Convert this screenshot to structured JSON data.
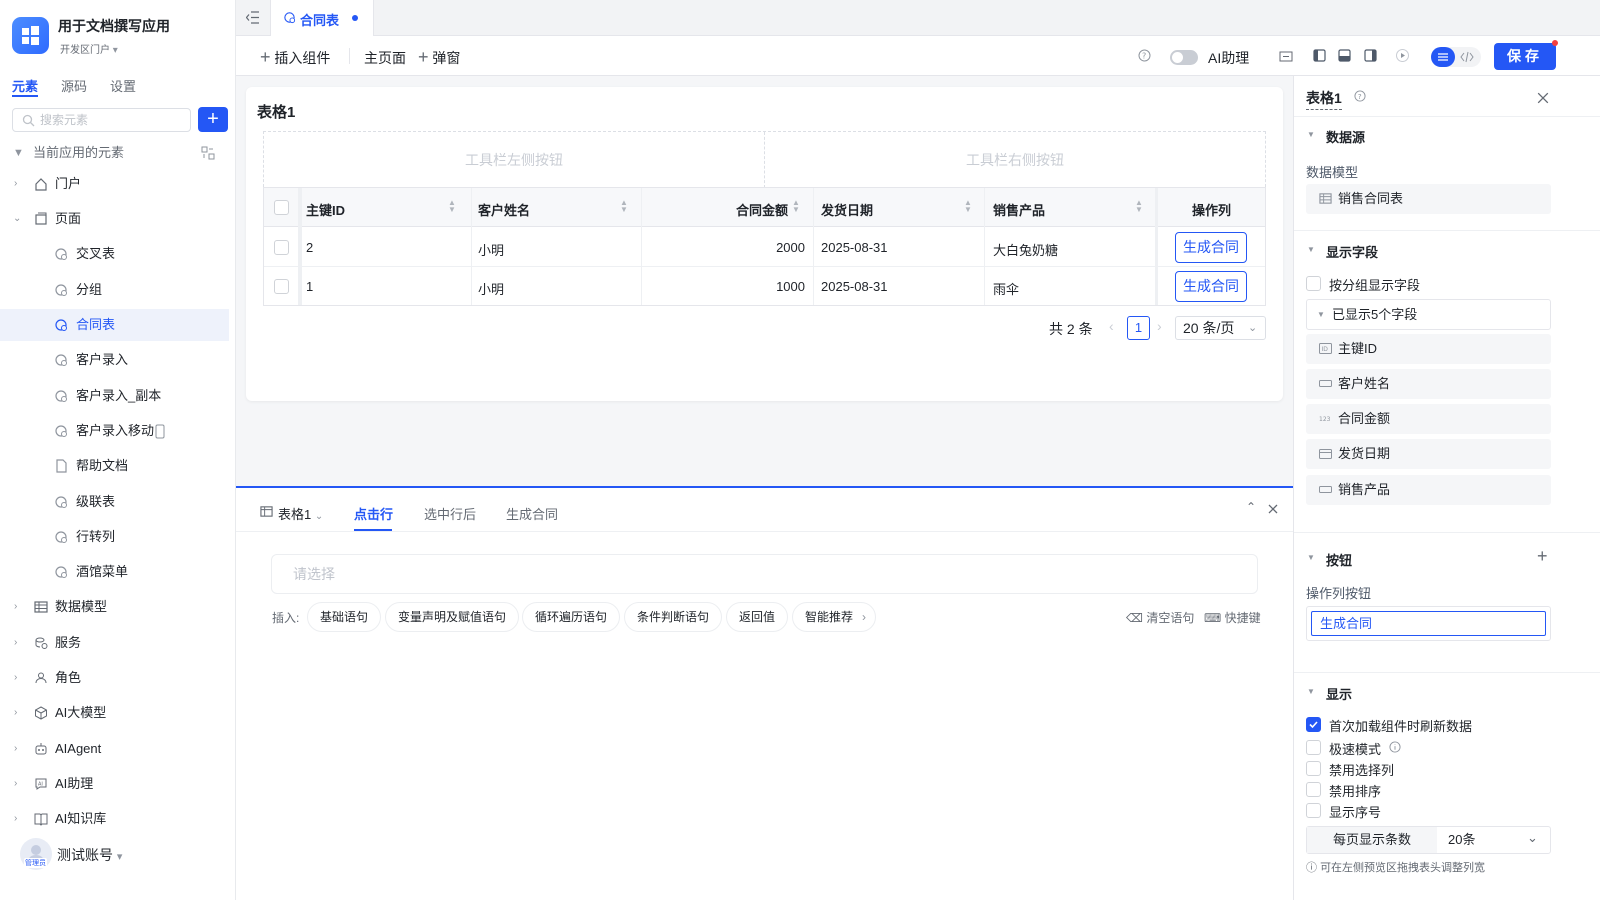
{
  "app": {
    "title": "用于文档撰写应用",
    "subtitle": "开发区门户"
  },
  "left_tabs": [
    "元素",
    "源码",
    "设置"
  ],
  "search": {
    "placeholder": "搜索元素"
  },
  "tree": {
    "root_label": "当前应用的元素",
    "items": [
      {
        "label": "门户"
      },
      {
        "label": "页面"
      },
      {
        "label": "交叉表"
      },
      {
        "label": "分组"
      },
      {
        "label": "合同表"
      },
      {
        "label": "客户录入"
      },
      {
        "label": "客户录入_副本"
      },
      {
        "label": "客户录入移动"
      },
      {
        "label": "帮助文档"
      },
      {
        "label": "级联表"
      },
      {
        "label": "行转列"
      },
      {
        "label": "酒馆菜单"
      },
      {
        "label": "数据模型"
      },
      {
        "label": "服务"
      },
      {
        "label": "角色"
      },
      {
        "label": "AI大模型"
      },
      {
        "label": "AIAgent"
      },
      {
        "label": "AI助理"
      },
      {
        "label": "AI知识库"
      }
    ]
  },
  "user": {
    "name": "测试账号",
    "role": "管理员"
  },
  "file_tab": {
    "label": "合同表"
  },
  "toolbar": {
    "insert": "插入组件",
    "main_page": "主页面",
    "popup": "弹窗",
    "ai_assistant": "AI助理",
    "save": "保存"
  },
  "card": {
    "title": "表格1",
    "toolbar_left": "工具栏左侧按钮",
    "toolbar_right": "工具栏右侧按钮",
    "columns": [
      "主键ID",
      "客户姓名",
      "合同金额",
      "发货日期",
      "销售产品",
      "操作列"
    ],
    "rows": [
      {
        "id": "2",
        "name": "小明",
        "amount": "2000",
        "date": "2025-08-31",
        "product": "大白兔奶糖",
        "action": "生成合同"
      },
      {
        "id": "1",
        "name": "小明",
        "amount": "1000",
        "date": "2025-08-31",
        "product": "雨伞",
        "action": "生成合同"
      }
    ],
    "pagination": {
      "total": "共 2 条",
      "page": "1",
      "page_size": "20 条/页"
    }
  },
  "bottom": {
    "component": "表格1",
    "tabs": [
      "点击行",
      "选中行后",
      "生成合同"
    ],
    "select_placeholder": "请选择",
    "insert_label": "插入:",
    "chips": [
      "基础语句",
      "变量声明及赋值语句",
      "循环遍历语句",
      "条件判断语句",
      "返回值",
      "智能推荐"
    ],
    "clear": "清空语句",
    "shortcut": "快捷键"
  },
  "right": {
    "title": "表格1",
    "datasource_title": "数据源",
    "model_label": "数据模型",
    "model_value": "销售合同表",
    "fields_title": "显示字段",
    "group_label": "按分组显示字段",
    "shown_count": "已显示5个字段",
    "fields": [
      {
        "label": "主键ID",
        "icon": "id-icon"
      },
      {
        "label": "客户姓名",
        "icon": "text-field-icon"
      },
      {
        "label": "合同金额",
        "icon": "number-icon"
      },
      {
        "label": "发货日期",
        "icon": "calendar-icon"
      },
      {
        "label": "销售产品",
        "icon": "text-field-icon"
      }
    ],
    "buttons_title": "按钮",
    "action_buttons_label": "操作列按钮",
    "action_button_value": "生成合同",
    "display_title": "显示",
    "options": [
      {
        "label": "首次加载组件时刷新数据",
        "checked": true
      },
      {
        "label": "极速模式",
        "checked": false
      },
      {
        "label": "禁用选择列",
        "checked": false
      },
      {
        "label": "禁用排序",
        "checked": false
      },
      {
        "label": "显示序号",
        "checked": false
      }
    ],
    "page_size_label": "每页显示条数",
    "page_size_value": "20条",
    "hint": "可在左侧预览区拖拽表头调整列宽"
  },
  "colors": {
    "accent": "#2457f5",
    "selected_bg": "#eef2fb"
  }
}
